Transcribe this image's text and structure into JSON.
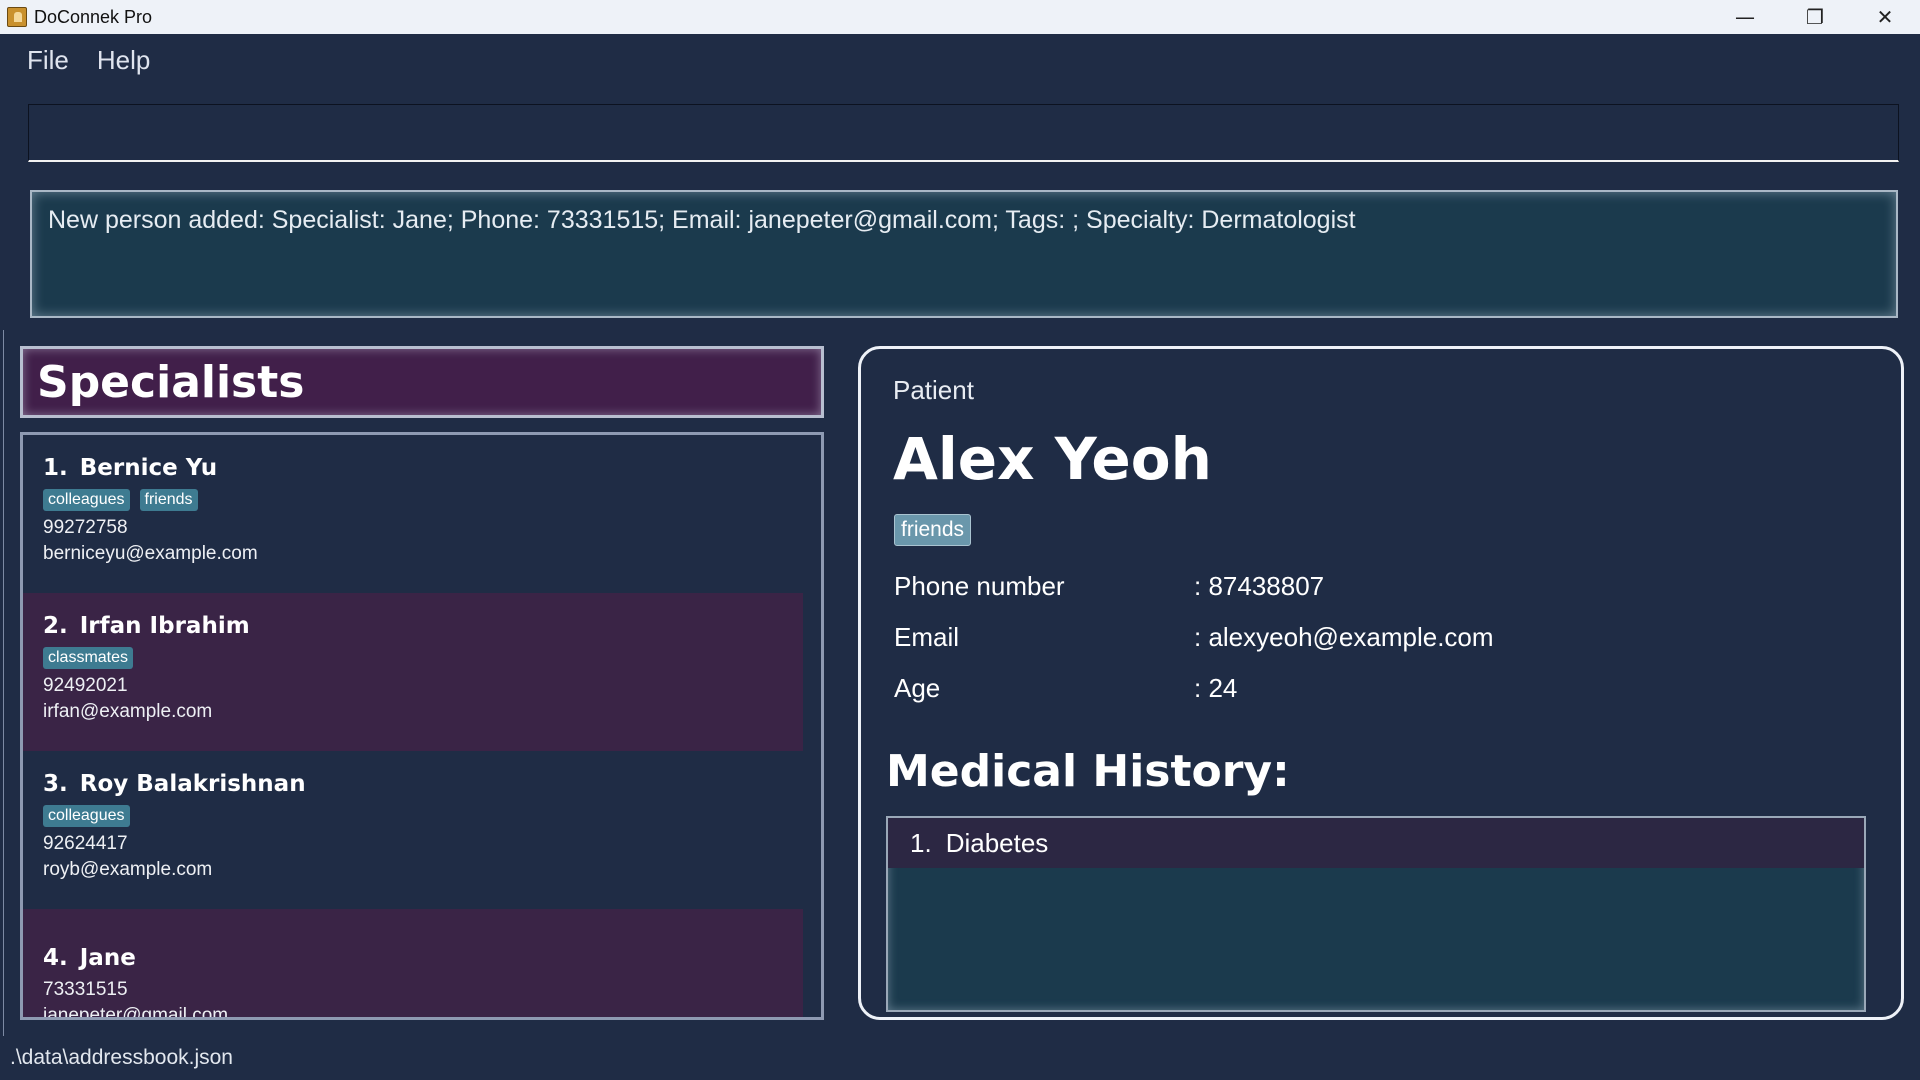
{
  "window": {
    "title": "DoConnek Pro",
    "controls": {
      "minimize": "—",
      "restore": "❐",
      "close": "✕"
    }
  },
  "menu": {
    "file": "File",
    "help": "Help"
  },
  "command": {
    "value": "",
    "placeholder": ""
  },
  "result": {
    "text": "New person added: Specialist: Jane; Phone: 73331515; Email: janepeter@gmail.com; Tags: ; Specialty: Dermatologist"
  },
  "specialists": {
    "title": "Specialists",
    "items": [
      {
        "index": "1.",
        "name": "Bernice Yu",
        "tags": [
          "colleagues",
          "friends"
        ],
        "phone": "99272758",
        "email": "berniceyu@example.com"
      },
      {
        "index": "2.",
        "name": "Irfan Ibrahim",
        "tags": [
          "classmates"
        ],
        "phone": "92492021",
        "email": "irfan@example.com"
      },
      {
        "index": "3.",
        "name": "Roy Balakrishnan",
        "tags": [
          "colleagues"
        ],
        "phone": "92624417",
        "email": "royb@example.com"
      },
      {
        "index": "4.",
        "name": "Jane",
        "tags": [],
        "phone": "73331515",
        "email": "janepeter@gmail.com"
      }
    ]
  },
  "patient": {
    "type": "Patient",
    "name": "Alex Yeoh",
    "tag": "friends",
    "fields": [
      {
        "label": "Phone number",
        "value": ": 87438807"
      },
      {
        "label": "Email",
        "value": ": alexyeoh@example.com"
      },
      {
        "label": "Age",
        "value": ": 24"
      }
    ],
    "history_title": "Medical History:",
    "history": [
      {
        "index": "1.",
        "condition": "Diabetes"
      }
    ]
  },
  "status": {
    "path": ".\\data\\addressbook.json"
  }
}
